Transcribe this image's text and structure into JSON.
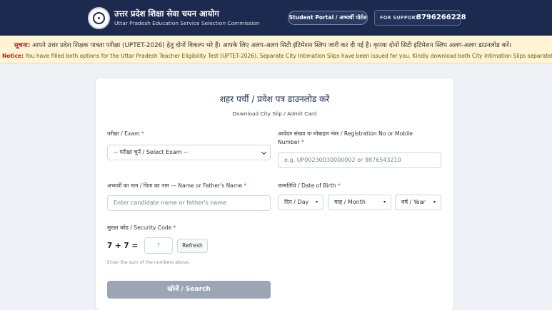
{
  "header": {
    "org_name_hi": "उत्तर प्रदेश शिक्षा सेवा चयन आयोग",
    "org_name_en": "Uttar Pradesh Education Service Selection Commission",
    "portal_button": "Student Portal / अभ्यर्थी पोर्टल",
    "support_label": "FOR SUPPORT",
    "support_phone": "8796266228"
  },
  "notice": {
    "hi_label": "सूचना:",
    "hi_text": " आपने उत्तर प्रदेश शिक्षक पात्रता परीक्षा (UPTET-2026) हेतु दोनों विकल्प भरे हैं। आपके लिए अलग-अलग सिटी इंटिमेशन स्लिप जारी कर दी गई है। कृपया दोनों सिटी इंटिमेशन स्लिप अलग-अलग डाउनलोड करें।",
    "en_label": "Notice:",
    "en_text": " You have filled both options for the Uttar Pradesh Teacher Eligibility Test (UPTET-2026). Separate City Intimation Slips have been issued for you. Kindly download both City Intimation Slips separately."
  },
  "form": {
    "title": "शहर पर्ची / प्रवेश पत्र डाउनलोड करें",
    "subtitle": "Download City Slip / Admit Card",
    "exam_label": "परीक्षा / Exam",
    "exam_selected": "-- परीक्षा चुनें / Select Exam --",
    "regno_label": "आवेदन संख्या या मोबाइल नंबर / Registration No or Mobile Number",
    "regno_placeholder": "e.g. UP00230030000002 or 9876543210",
    "name_label": "अभ्यर्थी का नाम / पिता का नाम — Name or Father's Name",
    "name_placeholder": "Enter candidate name or father's name",
    "dob_label": "जन्मतिथि / Date of Birth",
    "dob_day": "दिन / Day",
    "dob_month": "माह / Month",
    "dob_year": "वर्ष / Year",
    "captcha_label": "सुरक्षा कोड / Security Code",
    "captcha_equation": "7 + 7 =",
    "captcha_placeholder": "?",
    "refresh_label": "Refresh",
    "captcha_hint": "Enter the sum of the numbers above.",
    "search_label": "खोजें / Search",
    "required_mark": "*"
  },
  "colors": {
    "header_bg": "#1b2a4e",
    "notice_bg": "#fff4d4",
    "notice_label": "#b42318",
    "search_button": "#9da5b4"
  }
}
